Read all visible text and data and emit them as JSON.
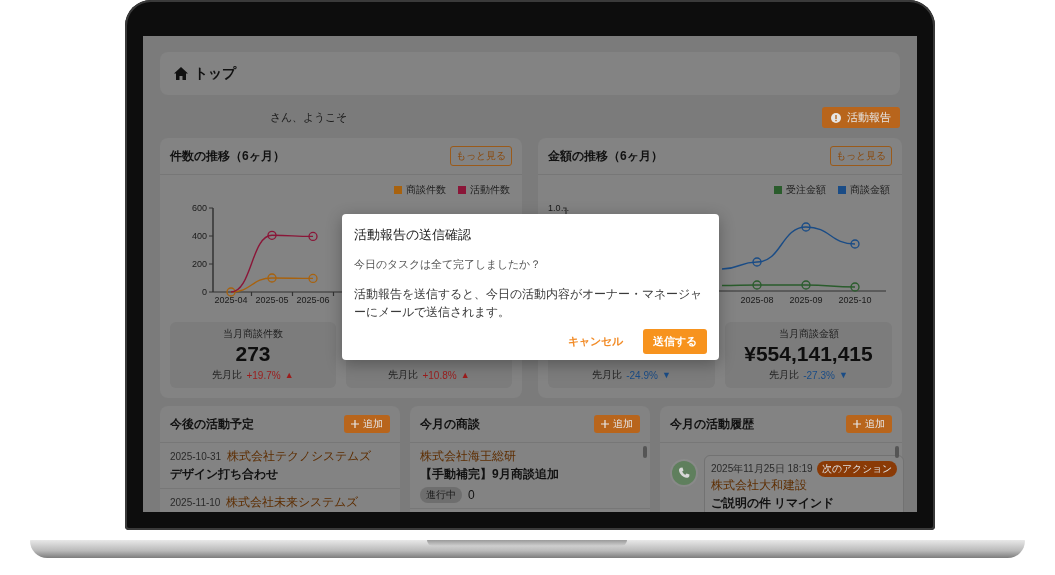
{
  "header": {
    "title": "トップ"
  },
  "welcome": {
    "text": "さん、ようこそ",
    "report_button": "活動報告"
  },
  "charts": [
    {
      "kind": "data",
      "title": "件数の推移（6ヶ月）",
      "more_button": "もっと見る",
      "chart_data": {
        "type": "line",
        "categories": [
          "2025-04",
          "2025-05",
          "2025-06"
        ],
        "series": [
          {
            "name": "商談件数",
            "color": "#a8620e",
            "marker": true,
            "values": [
              0,
              100,
              97
            ]
          },
          {
            "name": "活動件数",
            "color": "#8a1638",
            "marker": true,
            "values": [
              0,
              405,
              397
            ]
          }
        ],
        "ylim": [
          0,
          600
        ],
        "yticks": [
          0,
          200,
          400,
          600
        ]
      },
      "kpis": [
        {
          "label": "当月商談件数",
          "value": "273",
          "compare_label": "先月比",
          "change": "+19.7%",
          "arrow": "▲",
          "color": "#9c1c1c"
        },
        {
          "compare_label": "先月比",
          "change": "+10.8%",
          "arrow": "▲",
          "color": "#9c1c1c"
        }
      ]
    },
    {
      "kind": "picture",
      "title": "金額の推移（6ヶ月）",
      "more_button": "もっと見る",
      "legend": [
        {
          "name": "受注金額",
          "color": "#2a5c2c"
        },
        {
          "name": "商談金額",
          "color": "#1a4c86"
        }
      ],
      "y_axis_label": "1.0…",
      "x_axis_labels": [
        "2025-08",
        "2025-09",
        "2025-10"
      ],
      "kpis": [
        {
          "compare_label": "先月比",
          "change": "-24.9%",
          "arrow": "▼",
          "color": "#1a4c86"
        },
        {
          "label": "当月商談金額",
          "value": "¥554,141,415",
          "compare_label": "先月比",
          "change": "-27.3%",
          "arrow": "▼",
          "color": "#1a4c86"
        }
      ]
    }
  ],
  "panels": [
    {
      "kind": "schedule",
      "title": "今後の活動予定",
      "add_button": "追加",
      "items": [
        {
          "date": "2025-10-31",
          "company": "株式会社テクノシステムズ",
          "title": "デザイン打ち合わせ"
        },
        {
          "date": "2025-11-10",
          "company": "株式会社未来システムズ"
        }
      ]
    },
    {
      "kind": "deals",
      "title": "今月の商談",
      "add_button": "追加",
      "items": [
        {
          "company": "株式会社海王総研",
          "title": "【手動補完】9月商談追加",
          "status": "進行中",
          "amount": "0"
        }
      ]
    },
    {
      "kind": "history",
      "title": "今月の活動履歴",
      "add_button": "追加",
      "items": [
        {
          "datetime": "2025年11月25日 18:19",
          "badge": "次のアクション",
          "company": "株式会社大和建設",
          "title": "ご説明の件 リマインド"
        }
      ]
    }
  ],
  "dialog": {
    "title": "活動報告の送信確認",
    "question": "今日のタスクは全て完了しましたか？",
    "message": "活動報告を送信すると、今日の活動内容がオーナー・マネージャーにメールで送信されます。",
    "cancel": "キャンセル",
    "confirm": "送信する"
  }
}
